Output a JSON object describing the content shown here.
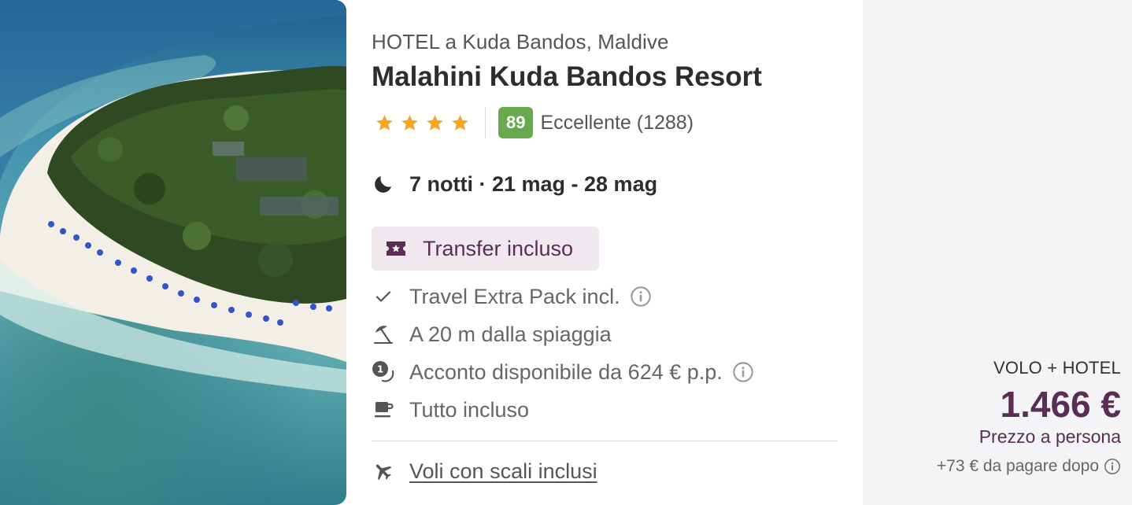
{
  "hotel": {
    "location": "HOTEL a Kuda Bandos, Maldive",
    "name": "Malahini Kuda Bandos Resort",
    "stars": 4,
    "score": "89",
    "rating_text": "Eccellente (1288)"
  },
  "stay": {
    "dates": "7 notti · 21 mag - 28 mag"
  },
  "badge": {
    "transfer": "Transfer incluso"
  },
  "features": [
    {
      "icon": "check-icon",
      "label": "Travel Extra Pack incl.",
      "has_info": true
    },
    {
      "icon": "beach-umbrella-icon",
      "label": "A 20 m dalla spiaggia",
      "has_info": false
    },
    {
      "icon": "deposit-coin-icon",
      "label": "Acconto disponibile da 624 € p.p.",
      "has_info": true
    },
    {
      "icon": "coffee-cup-icon",
      "label": "Tutto incluso",
      "has_info": false
    }
  ],
  "flights": {
    "icon": "airplane-icon",
    "label": "Voli con scali inclusi"
  },
  "price": {
    "package": "VOLO + HOTEL",
    "amount": "1.466 €",
    "per_person": "Prezzo a persona",
    "extra": "+73 € da pagare dopo"
  },
  "colors": {
    "brand": "#5b2d56",
    "badge_bg": "#f0e8ef",
    "score_green": "#6aa84f",
    "star": "#f5a623"
  }
}
